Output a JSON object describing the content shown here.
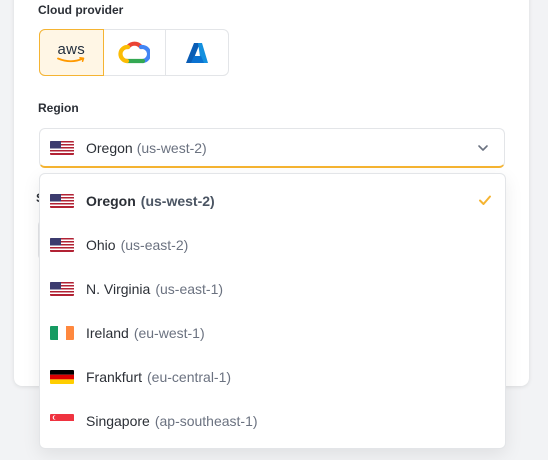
{
  "provider_section": {
    "label": "Cloud provider",
    "providers": [
      {
        "name": "AWS",
        "logo_text": "aws",
        "icon": "aws-logo",
        "selected": true
      },
      {
        "name": "Google Cloud",
        "icon": "google-cloud-logo",
        "selected": false
      },
      {
        "name": "Azure",
        "icon": "azure-logo",
        "selected": false
      }
    ]
  },
  "region_section": {
    "label": "Region",
    "selected": {
      "name": "Oregon",
      "code": "(us-west-2)",
      "flag": "us-flag"
    }
  },
  "hidden_label_fragment": "S",
  "dropdown": {
    "options": [
      {
        "name": "Oregon",
        "code": "(us-west-2)",
        "flag": "us-flag",
        "selected": true
      },
      {
        "name": "Ohio",
        "code": "(us-east-2)",
        "flag": "us-flag",
        "selected": false
      },
      {
        "name": "N. Virginia",
        "code": "(us-east-1)",
        "flag": "us-flag",
        "selected": false
      },
      {
        "name": "Ireland",
        "code": "(eu-west-1)",
        "flag": "ie-flag",
        "selected": false
      },
      {
        "name": "Frankfurt",
        "code": "(eu-central-1)",
        "flag": "de-flag",
        "selected": false
      },
      {
        "name": "Singapore",
        "code": "(ap-southeast-1)",
        "flag": "sg-flag",
        "selected": false
      }
    ]
  },
  "colors": {
    "accent": "#f5b432",
    "selected_bg": "#fff6e5",
    "border": "#e3e5e8"
  }
}
